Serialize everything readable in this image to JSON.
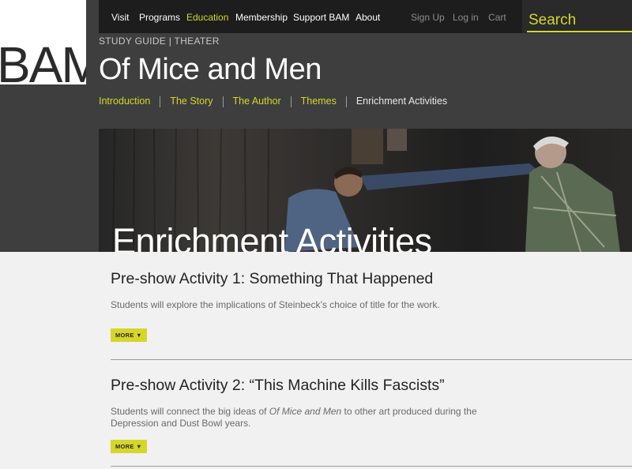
{
  "logo": {
    "text": "BAM"
  },
  "nav": {
    "items": [
      "Visit",
      "Programs",
      "Education",
      "Membership",
      "Support BAM",
      "About"
    ],
    "active_index": 2,
    "account": [
      "Sign Up",
      "Log in",
      "Cart"
    ]
  },
  "search": {
    "label": "Search"
  },
  "header": {
    "study_guide": "STUDY GUIDE | THEATER",
    "title": "Of Mice and Men"
  },
  "subnav": {
    "items": [
      "Introduction",
      "The Story",
      "The Author",
      "Themes",
      "Enrichment Activities"
    ],
    "current_index": 4
  },
  "hero": {
    "heading": "Enrichment Activities"
  },
  "activities": [
    {
      "title": "Pre-show Activity 1: Something That Happened",
      "desc_before": "Students will explore the implications of Steinbeck’s choice of title for the work.",
      "desc_italic": "",
      "desc_after": "",
      "more_label": "MORE"
    },
    {
      "title": "Pre-show Activity 2: “This Machine Kills Fascists”",
      "desc_before": "Students will connect the big ideas of ",
      "desc_italic": "Of Mice and Men",
      "desc_after": " to other art produced during the Depression and Dust Bowl years.",
      "more_label": "MORE"
    }
  ],
  "colors": {
    "accent": "#d6d62a",
    "dark": "#3e3e3e",
    "navbar": "#1d1d1d"
  }
}
